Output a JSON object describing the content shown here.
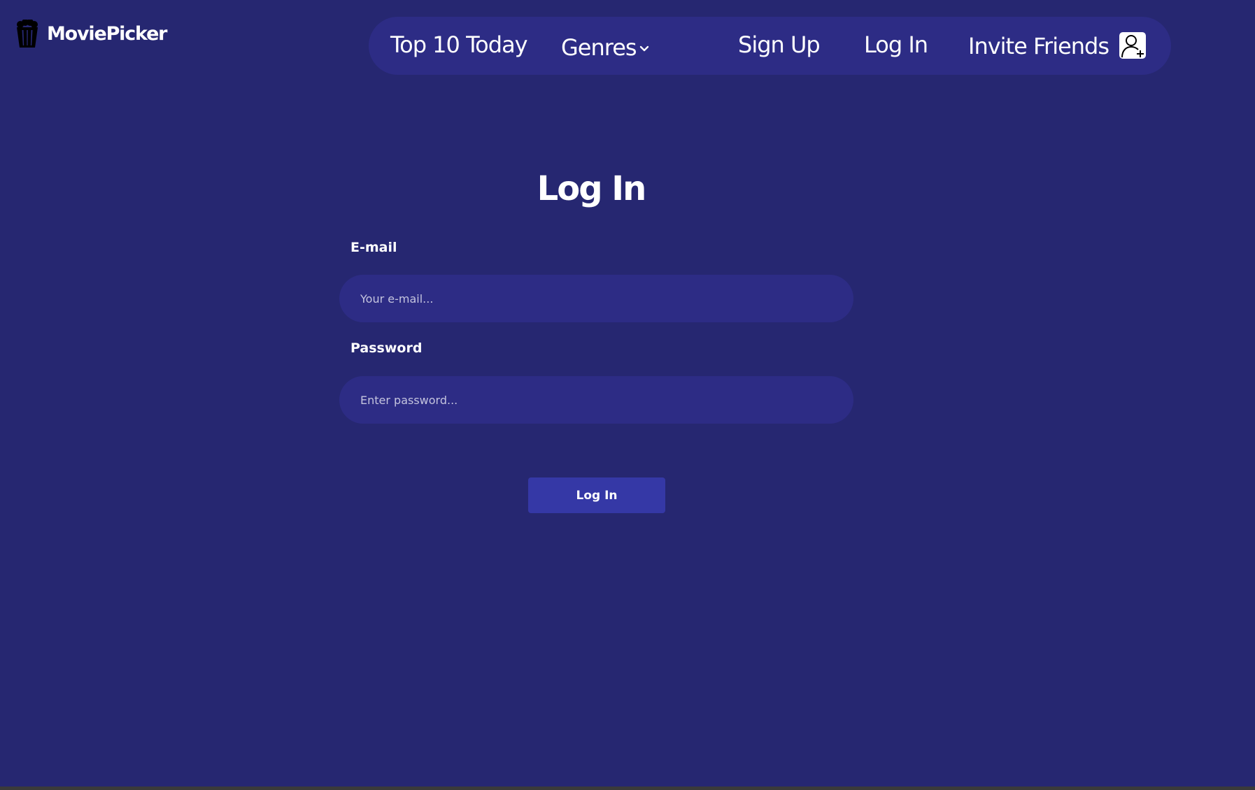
{
  "brand": {
    "name": "MoviePicker",
    "logo_icon": "popcorn-icon"
  },
  "nav": {
    "items": [
      {
        "label": "Top 10 Today"
      },
      {
        "label": "Genres",
        "icon": "chevron-down-icon"
      },
      {
        "label": "Sign Up"
      },
      {
        "label": "Log In"
      },
      {
        "label": "Invite Friends",
        "icon": "add-user-icon"
      }
    ]
  },
  "form": {
    "title": "Log In",
    "email": {
      "label": "E-mail",
      "placeholder": "Your e-mail...",
      "value": ""
    },
    "password": {
      "label": "Password",
      "placeholder": "Enter password...",
      "value": ""
    },
    "submit_label": "Log In"
  },
  "colors": {
    "background": "#262771",
    "surface": "#2d2c85",
    "button": "#3538a6",
    "text": "#ffffff"
  }
}
